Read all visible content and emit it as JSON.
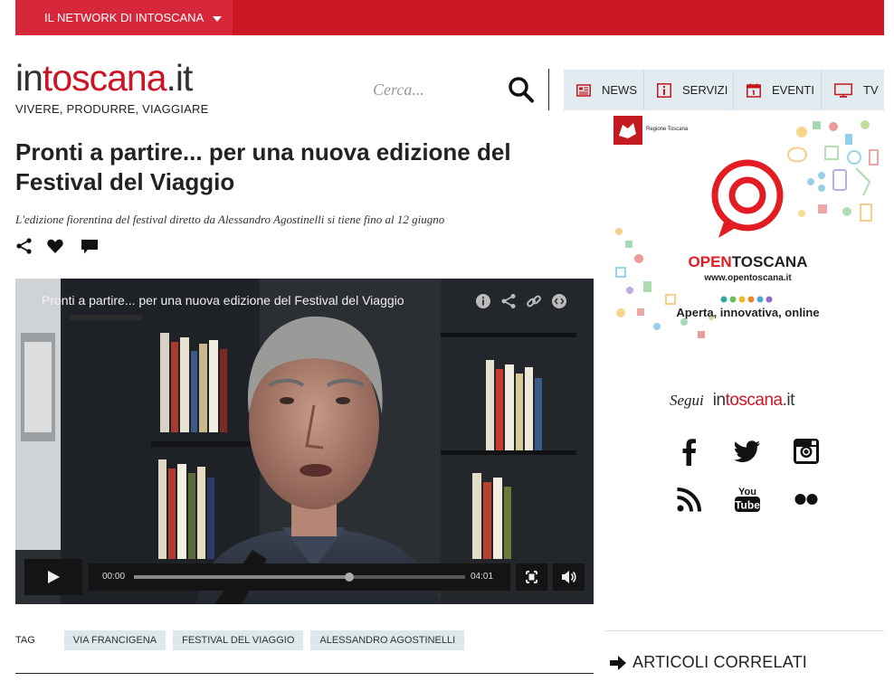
{
  "topbar": {
    "network_label": "IL NETWORK DI INTOSCANA"
  },
  "brand": {
    "logo_part1": "in",
    "logo_part2": "toscana",
    "logo_part3": ".it",
    "tagline": "VIVERE, PRODURRE, VIAGGIARE"
  },
  "search": {
    "placeholder": "Cerca..."
  },
  "nav": {
    "items": [
      {
        "label": "NEWS"
      },
      {
        "label": "SERVIZI"
      },
      {
        "label": "EVENTI"
      },
      {
        "label": "TV"
      }
    ]
  },
  "article": {
    "title": "Pronti a partire... per una nuova edizione del Festival del Viaggio",
    "subtitle": "L'edizione fiorentina del festival diretto da Alessandro Agostinelli si tiene fino al 12 giugno"
  },
  "video": {
    "title": "Pronti a partire... per una nuova edizione del Festival del Viaggio",
    "current_time": "00:00",
    "duration": "04:01",
    "progress": 0.65
  },
  "tags": {
    "label": "TAG",
    "items": [
      "VIA FRANCIGENA",
      "FESTIVAL DEL VIAGGIO",
      "ALESSANDRO AGOSTINELLI"
    ]
  },
  "ad": {
    "region": "Regione Toscana",
    "name_part1": "OPEN",
    "name_part2": "TOSCANA",
    "url": "www.opentoscana.it",
    "slogan": "Aperta, innovativa, online"
  },
  "follow": {
    "label": "Segui",
    "logo_part1": "in",
    "logo_part2": "toscana",
    "logo_part3": ".it"
  },
  "related": {
    "label": "ARTICOLI CORRELATI"
  },
  "colors": {
    "brand_red": "#cc1626",
    "nav_bg": "#e2ebef",
    "tag_bg": "#dde8ed"
  }
}
